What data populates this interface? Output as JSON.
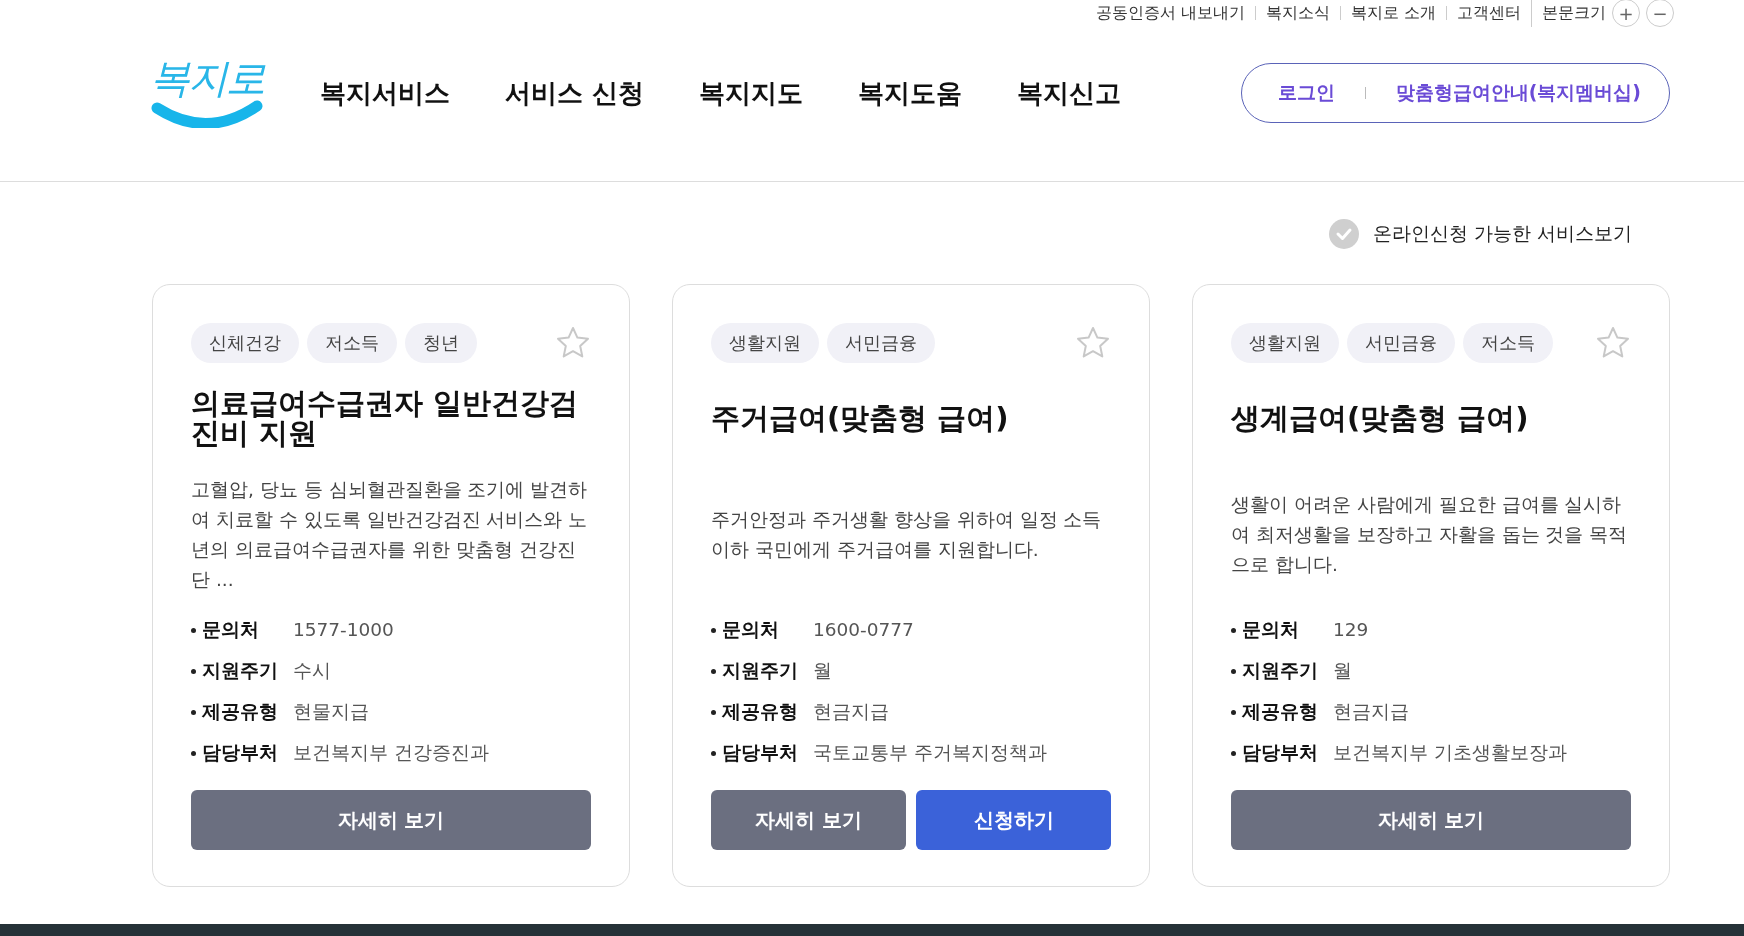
{
  "top_links": [
    "공동인증서 내보내기",
    "복지소식",
    "복지로 소개",
    "고객센터"
  ],
  "font_size": {
    "label": "본문크기",
    "buttons": [
      "+",
      "−"
    ]
  },
  "logo": {
    "text": "복지로"
  },
  "nav": [
    "복지서비스",
    "서비스 신청",
    "복지지도",
    "복지도움",
    "복지신고"
  ],
  "account": {
    "buttons": [
      "로그인",
      "맞춤형급여안내(복지멤버십)"
    ]
  },
  "online_filter": {
    "label": "온라인신청 가능한 서비스보기",
    "checked": false
  },
  "cards": [
    {
      "tags": [
        "신체건강",
        "저소득",
        "청년"
      ],
      "favorite": false,
      "title": "의료급여수급권자 일반건강검진비 지원",
      "description": "고혈압, 당뇨 등 심뇌혈관질환을 조기에 발견하여 치료할 수 있도록 일반건강검진 서비스와 노년의 의료급여수급권자를 위한 맞춤형 건강진단  ...",
      "info": [
        {
          "label": "문의처",
          "value": "1577-1000"
        },
        {
          "label": "지원주기",
          "value": "수시"
        },
        {
          "label": "제공유형",
          "value": "현물지급"
        },
        {
          "label": "담당부처",
          "value": "보건복지부 건강증진과"
        }
      ],
      "buttons": [
        {
          "kind": "detail",
          "label": "자세히 보기"
        }
      ]
    },
    {
      "tags": [
        "생활지원",
        "서민금융"
      ],
      "favorite": false,
      "title": "주거급여(맞춤형 급여)",
      "description": "주거안정과 주거생활 향상을 위하여 일정 소득 이하 국민에게 주거급여를 지원합니다.",
      "info": [
        {
          "label": "문의처",
          "value": "1600-0777"
        },
        {
          "label": "지원주기",
          "value": "월"
        },
        {
          "label": "제공유형",
          "value": "현금지급"
        },
        {
          "label": "담당부처",
          "value": "국토교통부 주거복지정책과"
        }
      ],
      "buttons": [
        {
          "kind": "detail",
          "label": "자세히 보기"
        },
        {
          "kind": "apply",
          "label": "신청하기"
        }
      ]
    },
    {
      "tags": [
        "생활지원",
        "서민금융",
        "저소득"
      ],
      "favorite": false,
      "title": "생계급여(맞춤형 급여)",
      "description": "생활이 어려운 사람에게 필요한 급여를 실시하여 최저생활을 보장하고 자활을 돕는 것을 목적으로 합니다.",
      "info": [
        {
          "label": "문의처",
          "value": "129"
        },
        {
          "label": "지원주기",
          "value": "월"
        },
        {
          "label": "제공유형",
          "value": "현금지급"
        },
        {
          "label": "담당부처",
          "value": "보건복지부 기초생활보장과"
        }
      ],
      "buttons": [
        {
          "kind": "detail",
          "label": "자세히 보기"
        }
      ]
    }
  ]
}
